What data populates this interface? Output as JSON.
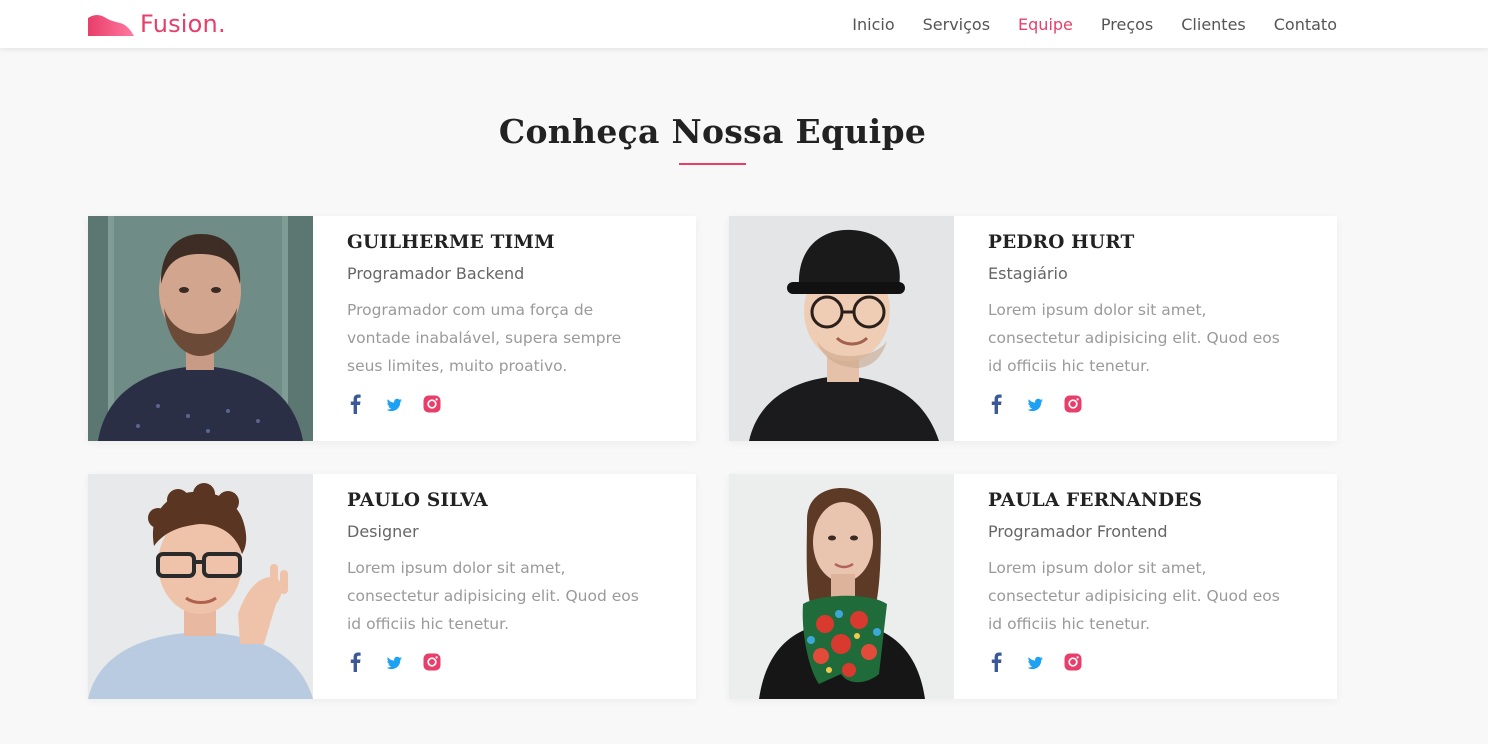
{
  "brand": {
    "name": "Fusion.",
    "logo_icon": "wave-logo-icon",
    "color": "#e83e6a"
  },
  "nav": {
    "items": [
      {
        "label": "Inicio",
        "active": false
      },
      {
        "label": "Serviços",
        "active": false
      },
      {
        "label": "Equipe",
        "active": true
      },
      {
        "label": "Preços",
        "active": false
      },
      {
        "label": "Clientes",
        "active": false
      },
      {
        "label": "Contato",
        "active": false
      }
    ]
  },
  "section": {
    "title": "Conheça Nossa Equipe",
    "accent": "#e83e6a"
  },
  "team": [
    {
      "name": "GUILHERME TIMM",
      "role": "Programador Backend",
      "description": "Programador com uma força de vontade inabalável, supera sempre seus limites, muito proativo.",
      "photo": "man-beard-portrait"
    },
    {
      "name": "PEDRO HURT",
      "role": "Estagiário",
      "description": "Lorem ipsum dolor sit amet, consectetur adipisicing elit. Quod eos id officiis hic tenetur.",
      "photo": "man-cap-glasses-portrait"
    },
    {
      "name": "PAULO SILVA",
      "role": "Designer",
      "description": "Lorem ipsum dolor sit amet, consectetur adipisicing elit. Quod eos id officiis hic tenetur.",
      "photo": "man-glasses-curly-hair-portrait"
    },
    {
      "name": "PAULA FERNANDES",
      "role": "Programador Frontend",
      "description": "Lorem ipsum dolor sit amet, consectetur adipisicing elit. Quod eos id officiis hic tenetur.",
      "photo": "woman-scarf-portrait"
    }
  ],
  "social_icons": {
    "facebook": {
      "icon": "facebook-icon",
      "color": "#3b5998"
    },
    "twitter": {
      "icon": "twitter-icon",
      "color": "#1da1f2"
    },
    "instagram": {
      "icon": "instagram-icon",
      "color": "#e83e6a"
    }
  }
}
